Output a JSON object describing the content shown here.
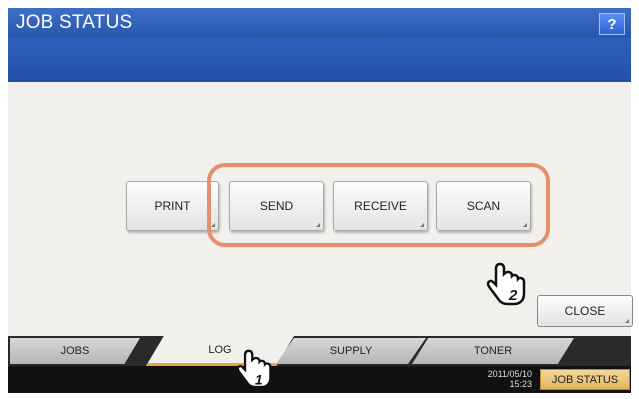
{
  "window": {
    "title": "JOB STATUS",
    "help_label": "?"
  },
  "main": {
    "buttons": [
      {
        "label": "PRINT"
      },
      {
        "label": "SEND"
      },
      {
        "label": "RECEIVE"
      },
      {
        "label": "SCAN"
      }
    ],
    "close_label": "CLOSE"
  },
  "tabs": [
    {
      "label": "JOBS"
    },
    {
      "label": "LOG"
    },
    {
      "label": "SUPPLY"
    },
    {
      "label": "TONER"
    }
  ],
  "status": {
    "date": "2011/05/10",
    "time": "15:23",
    "job_status_label": "JOB STATUS"
  },
  "callouts": {
    "step1": "1",
    "step2": "2",
    "highlight_color": "#e4906f"
  }
}
